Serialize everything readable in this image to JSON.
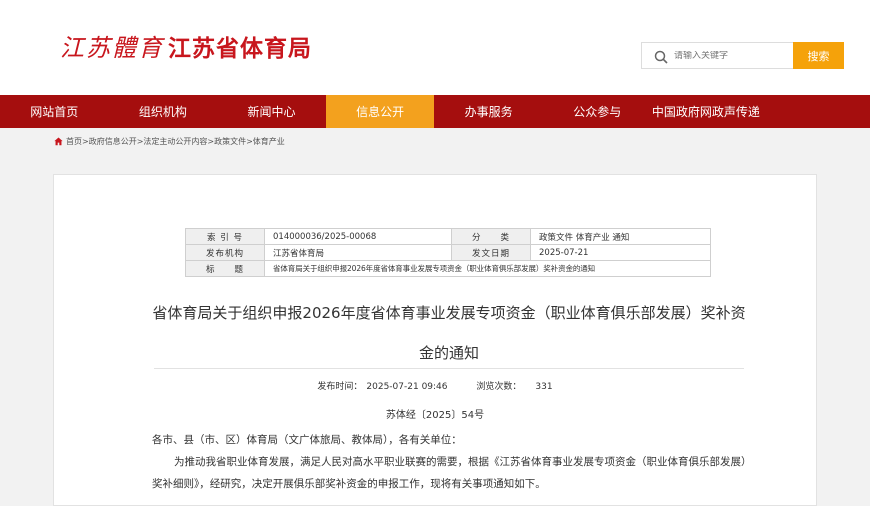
{
  "header": {
    "logo_calligraphy": "江苏體育",
    "logo_text": "江苏省体育局",
    "search_placeholder": "请输入关键字",
    "search_button": "搜索"
  },
  "nav": {
    "items": [
      {
        "label": "网站首页"
      },
      {
        "label": "组织机构"
      },
      {
        "label": "新闻中心"
      },
      {
        "label": "信息公开"
      },
      {
        "label": "办事服务"
      },
      {
        "label": "公众参与"
      },
      {
        "label": "中国政府网政声传递"
      }
    ],
    "active_index": 3
  },
  "breadcrumb": {
    "text": "首页>政府信息公开>法定主动公开内容>政策文件>体育产业"
  },
  "meta": {
    "index_label": "索 引 号",
    "index_value": "014000036/2025-00068",
    "category_label": "分　　类",
    "category_value": "政策文件 体育产业 通知",
    "org_label": "发布机构",
    "org_value": "江苏省体育局",
    "date_label": "发文日期",
    "date_value": "2025-07-21",
    "title_label": "标　　题",
    "title_value": "省体育局关于组织申报2026年度省体育事业发展专项资金（职业体育俱乐部发展）奖补资金的通知"
  },
  "article": {
    "title": "省体育局关于组织申报2026年度省体育事业发展专项资金（职业体育俱乐部发展）奖补资金的通知",
    "publish_label": "发布时间：",
    "publish_time": "2025-07-21 09:46",
    "views_label": "浏览次数：",
    "views": "331",
    "doc_number": "苏体经〔2025〕54号",
    "salutation": "各市、县（市、区）体育局（文广体旅局、教体局），各有关单位：",
    "paragraph1": "为推动我省职业体育发展，满足人民对高水平职业联赛的需要，根据《江苏省体育事业发展专项资金（职业体育俱乐部发展）奖补细则》，经研究，决定开展俱乐部奖补资金的申报工作，现将有关事项通知如下。"
  },
  "colors": {
    "brand_red": "#c8161d",
    "nav_bg": "#a50e0e",
    "accent_orange": "#f5a20a"
  }
}
